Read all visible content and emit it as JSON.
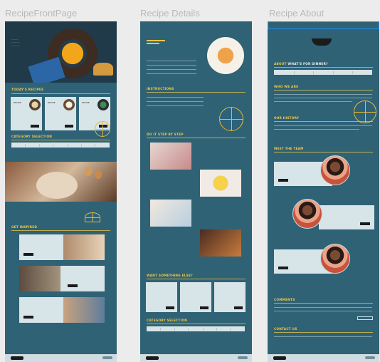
{
  "frames": [
    {
      "title": "RecipeFrontPage"
    },
    {
      "title": "Recipe Details"
    },
    {
      "title": "Recipe About"
    }
  ],
  "front": {
    "sections": {
      "todays": "TODAY'S RECIPES",
      "category": "CATEGORY SELECTION",
      "inspired": "GET INSPIRED"
    },
    "cards": [
      {
        "label": "RECIPE"
      },
      {
        "label": "RECIPE"
      },
      {
        "label": "RECIPE"
      }
    ]
  },
  "details": {
    "sections": {
      "instructions": "INSTRUCTIONS",
      "steps": "DO IT STEP BY STEP",
      "something": "WANT SOMETHING ELSE?",
      "category": "CATEGORY SELECTION"
    }
  },
  "about": {
    "sections": {
      "about_pre": "ABOUT",
      "about_post": "WHAT'S FOR DINNER?",
      "who": "WHO WE ARE",
      "history": "OUR HISTORY",
      "team": "MEET THE TEAM",
      "comments": "COMMENTS",
      "contact": "CONTACT US"
    }
  },
  "colors": {
    "board": "#2f6275",
    "accent": "#f0c646",
    "red": "#e9543b",
    "card": "#d7e4e8"
  }
}
